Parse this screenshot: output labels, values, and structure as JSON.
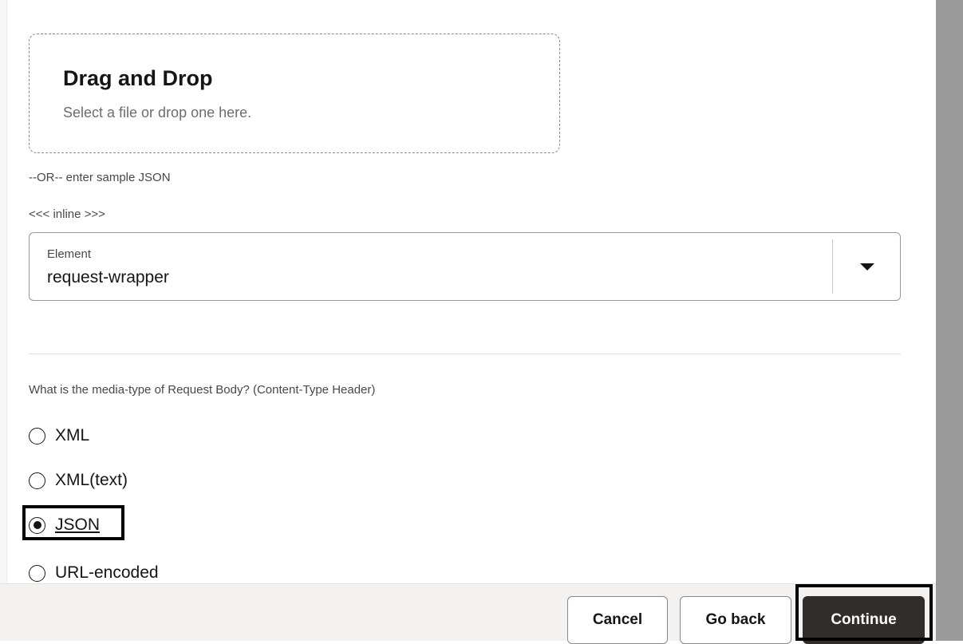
{
  "dropzone": {
    "title": "Drag and Drop",
    "subtitle": "Select a file or drop one here."
  },
  "or_text": "--OR-- enter sample JSON",
  "inline_text": "<<< inline >>>",
  "element_select": {
    "label": "Element",
    "value": "request-wrapper"
  },
  "media_type": {
    "question": "What is the media-type of Request Body? (Content-Type Header)",
    "options": [
      {
        "label": "XML",
        "selected": false
      },
      {
        "label": "XML(text)",
        "selected": false
      },
      {
        "label": "JSON",
        "selected": true
      },
      {
        "label": "URL-encoded",
        "selected": false
      }
    ]
  },
  "footer": {
    "cancel_label": "Cancel",
    "goback_label": "Go back",
    "continue_label": "Continue"
  },
  "colors": {
    "primary_button": "#312d2a",
    "footer_bg": "#f3f2f0",
    "scrollbar": "#9a9a9a"
  }
}
